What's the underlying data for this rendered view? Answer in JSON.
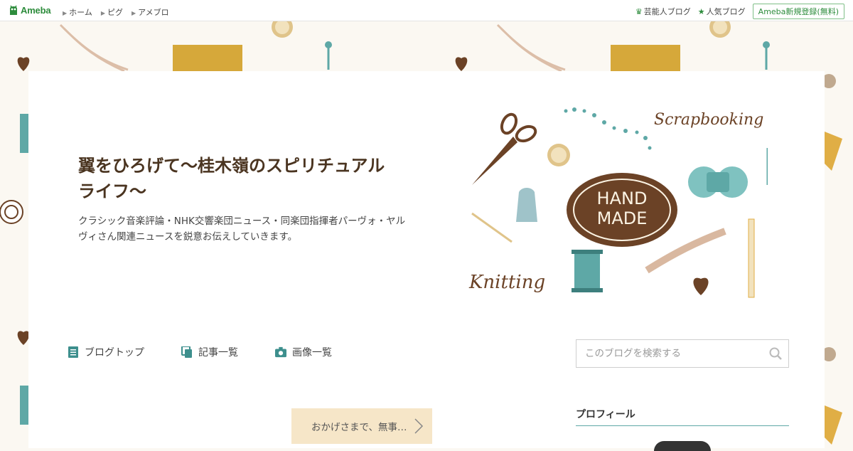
{
  "topbar": {
    "logo_text": "Ameba",
    "nav": [
      {
        "label": "ホーム"
      },
      {
        "label": "ピグ"
      },
      {
        "label": "アメブロ"
      }
    ],
    "right": {
      "celebrity_blog": "芸能人ブログ",
      "popular_blog": "人気ブログ",
      "signup": "Ameba新規登録(無料)"
    }
  },
  "header": {
    "title": "翼をひろげて～桂木嶺のスピリチュアルライフ～",
    "description": "クラシック音楽評論・NHK交響楽団ニュース・同楽団指揮者パーヴォ・ヤルヴィさん関連ニュースを鋭意お伝えしていきます。",
    "art_labels": {
      "badge_line1": "HAND",
      "badge_line2": "MADE",
      "scrapbooking": "Scrapbooking",
      "knitting": "Knitting"
    }
  },
  "blognav": {
    "items": [
      {
        "label": "ブログトップ",
        "icon": "document-icon"
      },
      {
        "label": "記事一覧",
        "icon": "copy-icon"
      },
      {
        "label": "画像一覧",
        "icon": "camera-icon"
      }
    ]
  },
  "search": {
    "placeholder": "このブログを検索する"
  },
  "entry": {
    "label": "おかげさまで、無事…"
  },
  "sidebar": {
    "profile_heading": "プロフィール"
  },
  "colors": {
    "brand": "#2d8c3c",
    "accent_teal": "#5ea8a6",
    "brown": "#6b4226",
    "entry_bg": "#f6e6c8"
  }
}
